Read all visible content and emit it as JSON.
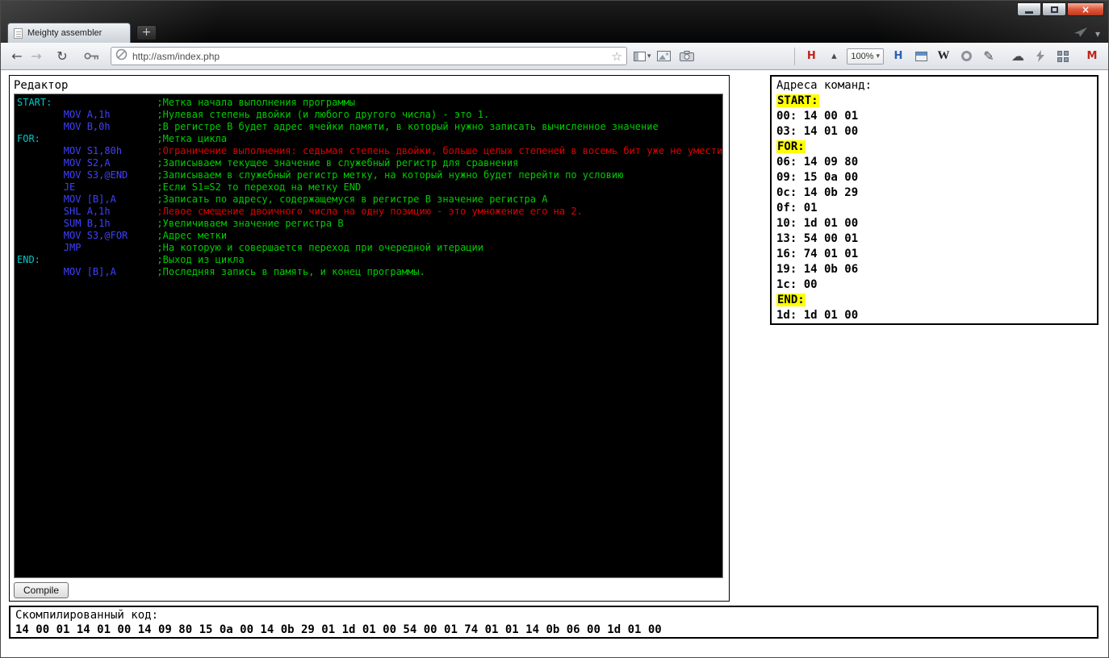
{
  "window_controls": {
    "close_glyph": "×"
  },
  "browser": {
    "tab_title": "Meighty assembler",
    "new_tab_glyph": "+",
    "url": "http://asm/index.php",
    "zoom_level": "100%"
  },
  "icons": {
    "back": "←",
    "forward": "→",
    "reload": "↻",
    "star": "☆",
    "caret_down": "▾",
    "zoom_up": "▴",
    "pencil": "✎",
    "cloud": "☁",
    "wikipedia": "W",
    "validator": "H",
    "history": "H",
    "gmail": "M"
  },
  "page": {
    "editor": {
      "title": "Редактор",
      "compile_label": "Compile",
      "colors": {
        "background": "#000000",
        "label": "#00c8c8",
        "instruction": "#4040ff",
        "comment_green": "#00cc00",
        "comment_red": "#e00000"
      },
      "lines": [
        {
          "label": "START:",
          "instr": "",
          "comment": ";Метка начала выполнения программы",
          "comment_color": "comment_green"
        },
        {
          "label": "",
          "instr": "MOV A,1h",
          "comment": ";Нулевая степень двойки (и любого другого числа) - это 1.",
          "comment_color": "comment_green"
        },
        {
          "label": "",
          "instr": "MOV B,0h",
          "comment": ";В регистре B будет адрес ячейки памяти, в который нужно записать вычисленное значение",
          "comment_color": "comment_green"
        },
        {
          "label": "FOR:",
          "instr": "",
          "comment": ";Метка цикла",
          "comment_color": "comment_green"
        },
        {
          "label": "",
          "instr": "MOV S1,80h",
          "comment": ";Ограничение выполнения: седьмая степень двойки, больше целых степеней в восемь бит уже не уместится.",
          "comment_color": "comment_red"
        },
        {
          "label": "",
          "instr": "MOV S2,A",
          "comment": ";Записываем текущее значение в служебный регистр для сравнения",
          "comment_color": "comment_green"
        },
        {
          "label": "",
          "instr": "MOV S3,@END",
          "comment": ";Записываем в служебный регистр метку, на который нужно будет перейти по условию",
          "comment_color": "comment_green"
        },
        {
          "label": "",
          "instr": "JE",
          "comment": ";Если S1=S2 то переход на метку END",
          "comment_color": "comment_green"
        },
        {
          "label": "",
          "instr": "MOV [B],A",
          "comment": ";Записать по адресу, содержащемуся в регистре B значение регистра A",
          "comment_color": "comment_green"
        },
        {
          "label": "",
          "instr": "SHL A,1h",
          "comment": ";Левое смещение двоичного числа на одну позицию - это умножение его на 2.",
          "comment_color": "comment_red"
        },
        {
          "label": "",
          "instr": "SUM B,1h",
          "comment": ";Увеличиваем значение регистра B",
          "comment_color": "comment_green"
        },
        {
          "label": "",
          "instr": "MOV S3,@FOR",
          "comment": ";Адрес метки",
          "comment_color": "comment_green"
        },
        {
          "label": "",
          "instr": "JMP",
          "comment": ";На которую и совершается переход при очередной итерации",
          "comment_color": "comment_green"
        },
        {
          "label": "END:",
          "instr": "",
          "comment": ";Выход из цикла",
          "comment_color": "comment_green"
        },
        {
          "label": "",
          "instr": "MOV [B],A",
          "comment": ";Последняя запись в память, и конец программы.",
          "comment_color": "comment_green"
        }
      ]
    },
    "addresses": {
      "title": "Адреса команд:",
      "highlight_color": "#ffff00",
      "rows": [
        {
          "type": "label",
          "text": "START:"
        },
        {
          "type": "addr",
          "addr": "00:",
          "bytes": "14 00 01"
        },
        {
          "type": "addr",
          "addr": "03:",
          "bytes": "14 01 00"
        },
        {
          "type": "label",
          "text": "FOR:"
        },
        {
          "type": "addr",
          "addr": "06:",
          "bytes": "14 09 80"
        },
        {
          "type": "addr",
          "addr": "09:",
          "bytes": "15 0a 00"
        },
        {
          "type": "addr",
          "addr": "0c:",
          "bytes": "14 0b 29"
        },
        {
          "type": "addr",
          "addr": "0f:",
          "bytes": "01"
        },
        {
          "type": "addr",
          "addr": "10:",
          "bytes": "1d 01 00"
        },
        {
          "type": "addr",
          "addr": "13:",
          "bytes": "54 00 01"
        },
        {
          "type": "addr",
          "addr": "16:",
          "bytes": "74 01 01"
        },
        {
          "type": "addr",
          "addr": "19:",
          "bytes": "14 0b 06"
        },
        {
          "type": "addr",
          "addr": "1c:",
          "bytes": "00"
        },
        {
          "type": "label",
          "text": "END:"
        },
        {
          "type": "addr",
          "addr": "1d:",
          "bytes": "1d 01 00"
        }
      ]
    },
    "compiled": {
      "title": "Скомпилированный код:",
      "code": "14 00 01 14 01 00 14 09 80 15 0a 00 14 0b 29 01 1d 01 00 54 00 01 74 01 01 14 0b 06 00 1d 01 00"
    }
  }
}
